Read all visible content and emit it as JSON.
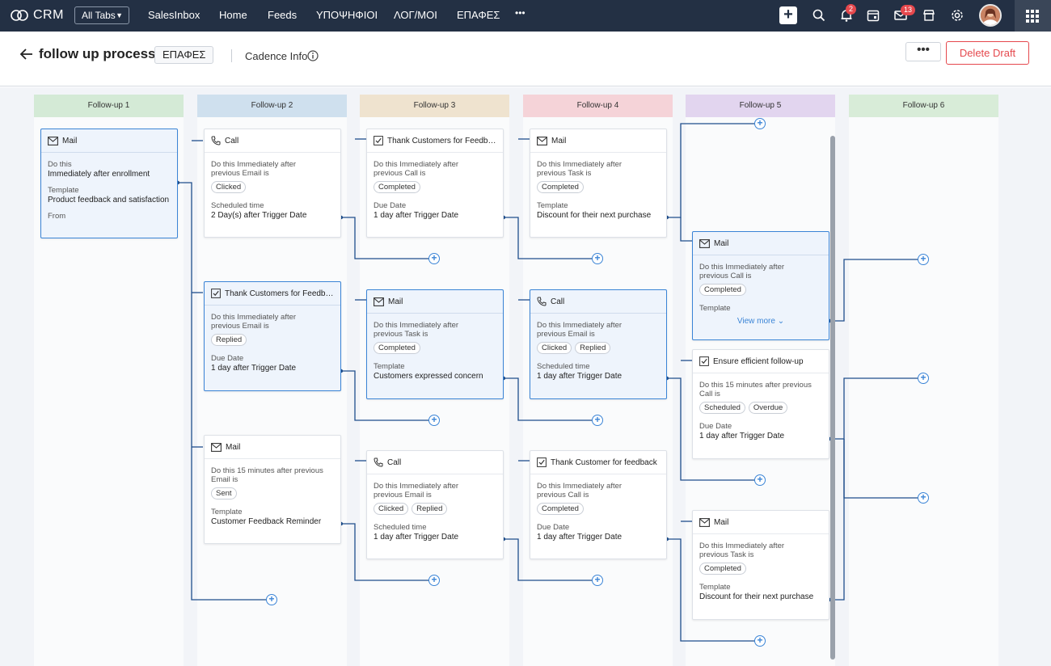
{
  "app": {
    "name": "CRM",
    "all_tabs": "All Tabs"
  },
  "nav": [
    "SalesInbox",
    "Home",
    "Feeds",
    "ΥΠΟΨΗΦΙΟΙ",
    "ΛΟΓ/ΜΟΙ",
    "ΕΠΑΦΕΣ"
  ],
  "nav_more": "•••",
  "badges": {
    "notifications": "2",
    "mail": "13"
  },
  "header": {
    "title": "follow up process",
    "module": "ΕΠΑΦΕΣ",
    "cadence_info": "Cadence Info",
    "more": "•••",
    "delete": "Delete Draft"
  },
  "columns": [
    {
      "label": "Follow-up 1",
      "color": "#d4ead6"
    },
    {
      "label": "Follow-up 2",
      "color": "#cfe0ee"
    },
    {
      "label": "Follow-up 3",
      "color": "#efe3cf"
    },
    {
      "label": "Follow-up 4",
      "color": "#f5d3d8"
    },
    {
      "label": "Follow-up 5",
      "color": "#e2d5ef"
    },
    {
      "label": "Follow-up 6",
      "color": "#d8ecd8"
    }
  ],
  "cards": [
    {
      "icon": "mail-icon",
      "title": "Mail",
      "l1": "Do this",
      "v1": "Immediately after enrollment",
      "l2": "Template",
      "v2": "Product feedback and satisfaction",
      "l3": "From"
    },
    {
      "icon": "phone-icon",
      "title": "Call",
      "cond1": "Do this Immediately after",
      "cond2": "previous Email is",
      "chips": [
        "Clicked"
      ],
      "l2": "Scheduled time",
      "v2": "2 Day(s) after Trigger Date"
    },
    {
      "icon": "task-icon",
      "title": "Thank Customers for Feedback",
      "cond1": "Do this Immediately after",
      "cond2": "previous Email is",
      "chips": [
        "Replied"
      ],
      "l2": "Due Date",
      "v2": "1 day after Trigger Date"
    },
    {
      "icon": "mail-icon",
      "title": "Mail",
      "cond1": "Do this 15 minutes after previous",
      "cond2": "Email is",
      "chips": [
        "Sent"
      ],
      "l2": "Template",
      "v2": "Customer Feedback Reminder"
    },
    {
      "icon": "task-icon",
      "title": "Thank Customers for Feedback",
      "cond1": "Do this Immediately after",
      "cond2": "previous Call is",
      "chips": [
        "Completed"
      ],
      "l2": "Due Date",
      "v2": "1 day after Trigger Date"
    },
    {
      "icon": "mail-icon",
      "title": "Mail",
      "cond1": "Do this Immediately after",
      "cond2": "previous Task is",
      "chips": [
        "Completed"
      ],
      "l2": "Template",
      "v2": "Customers expressed concern"
    },
    {
      "icon": "phone-icon",
      "title": "Call",
      "cond1": "Do this Immediately after",
      "cond2": "previous Email is",
      "chips": [
        "Clicked",
        "Replied"
      ],
      "l2": "Scheduled time",
      "v2": "1 day after Trigger Date"
    },
    {
      "icon": "mail-icon",
      "title": "Mail",
      "cond1": "Do this Immediately after",
      "cond2": "previous Task is",
      "chips": [
        "Completed"
      ],
      "l2": "Template",
      "v2": "Discount for their next purchase"
    },
    {
      "icon": "phone-icon",
      "title": "Call",
      "cond1": "Do this Immediately after",
      "cond2": "previous Email is",
      "chips": [
        "Clicked",
        "Replied"
      ],
      "l2": "Scheduled time",
      "v2": "1 day after Trigger Date"
    },
    {
      "icon": "task-icon",
      "title": "Thank Customer for feedback",
      "cond1": "Do this Immediately after",
      "cond2": "previous Call is",
      "chips": [
        "Completed"
      ],
      "l2": "Due Date",
      "v2": "1 day after Trigger Date"
    },
    {
      "icon": "mail-icon",
      "title": "Mail",
      "cond1": "Do this Immediately after",
      "cond2": "previous Call is",
      "chips": [
        "Completed"
      ],
      "l2": "Template",
      "view_more": "View more"
    },
    {
      "icon": "task-icon",
      "title": "Ensure efficient follow-up",
      "cond1": "Do this 15 minutes after previous",
      "cond2": "Call is",
      "chips": [
        "Scheduled",
        "Overdue"
      ],
      "l2": "Due Date",
      "v2": "1 day after Trigger Date"
    },
    {
      "icon": "mail-icon",
      "title": "Mail",
      "cond1": "Do this Immediately after",
      "cond2": "previous Task is",
      "chips": [
        "Completed"
      ],
      "l2": "Template",
      "v2": "Discount for their next purchase"
    }
  ]
}
